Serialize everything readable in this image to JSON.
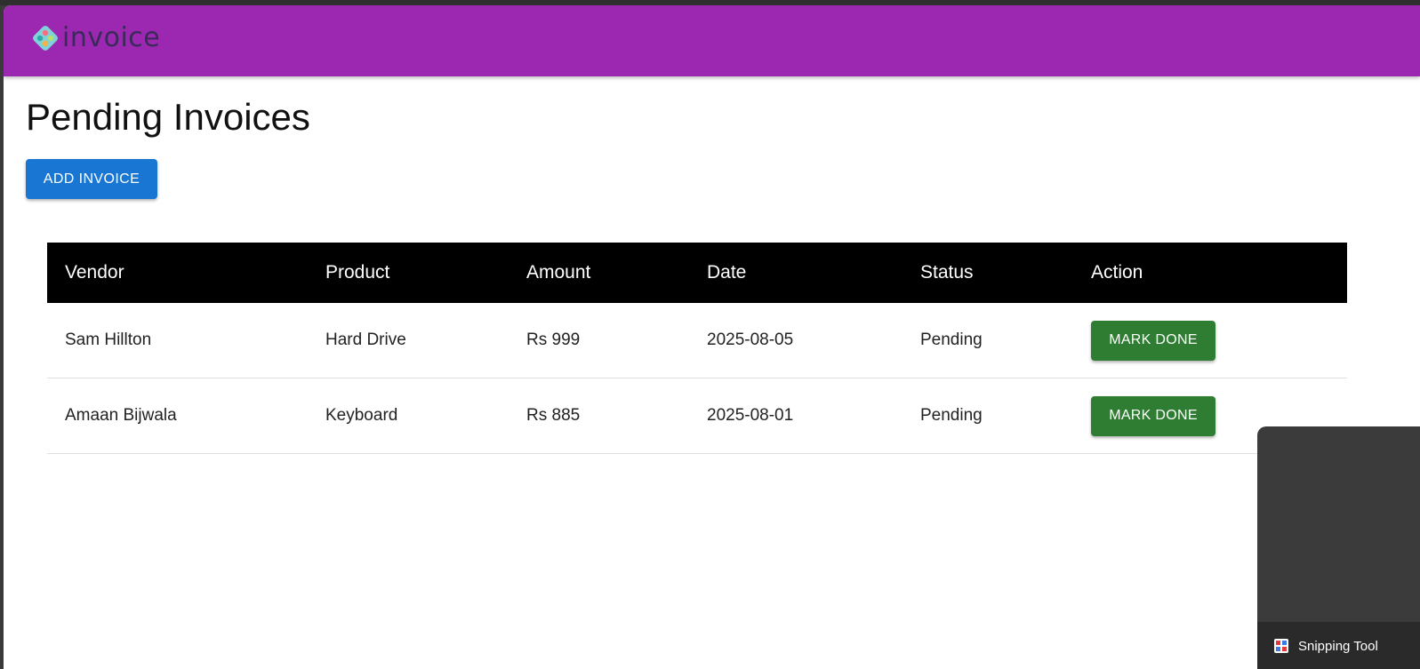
{
  "app": {
    "logo_text": "invoice",
    "brand_color": "#9c27b0"
  },
  "page": {
    "title": "Pending Invoices",
    "add_button_label": "ADD INVOICE"
  },
  "table": {
    "headers": [
      "Vendor",
      "Product",
      "Amount",
      "Date",
      "Status",
      "Action"
    ],
    "rows": [
      {
        "vendor": "Sam Hillton",
        "product": "Hard Drive",
        "amount": "Rs 999",
        "date": "2025-08-05",
        "status": "Pending",
        "action_label": "MARK DONE"
      },
      {
        "vendor": "Amaan Bijwala",
        "product": "Keyboard",
        "amount": "Rs 885",
        "date": "2025-08-01",
        "status": "Pending",
        "action_label": "MARK DONE"
      }
    ]
  },
  "taskbar_popup": {
    "app_label": "Snipping Tool",
    "icon": "snipping-tool-icon"
  },
  "colors": {
    "add_button": "#1976d2",
    "mark_done_button": "#2e7d32",
    "table_header": "#000000"
  }
}
